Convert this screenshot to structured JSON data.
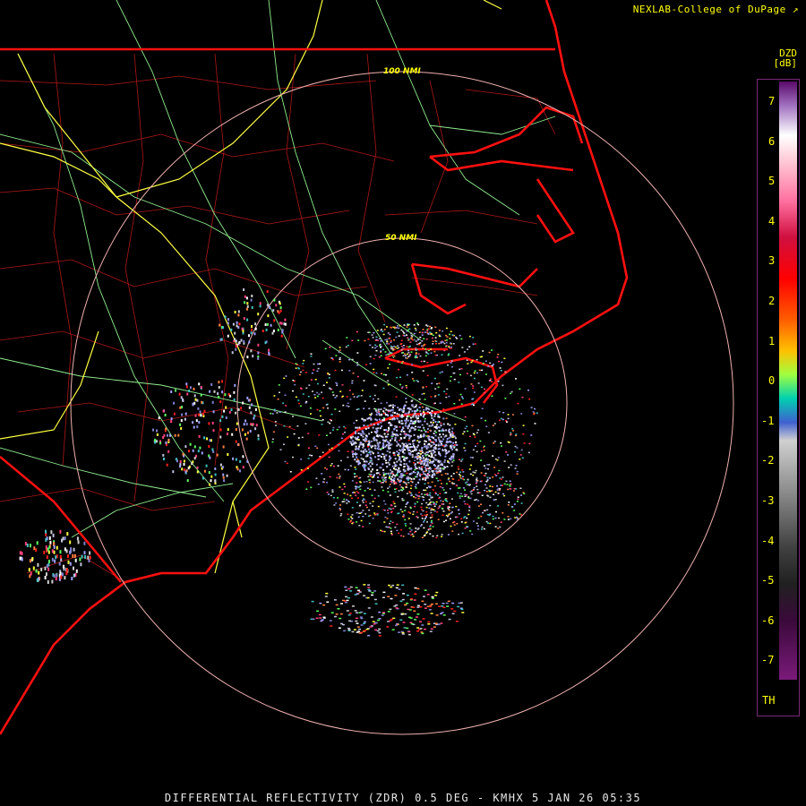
{
  "credit": "NEXLAB-College of DuPage",
  "footer": "DIFFERENTIAL REFLECTIVITY (ZDR) 0.5 DEG - KMHX 5 JAN 26 05:35",
  "rings": [
    {
      "label": "50 NMI"
    },
    {
      "label": "100 NMI"
    }
  ],
  "scale": {
    "product": "DZD",
    "unit": "[dB]",
    "labels": [
      "7",
      "6",
      "5",
      "4",
      "3",
      "2",
      "1",
      "0",
      "-1",
      "-2",
      "-3",
      "-4",
      "-5",
      "-6",
      "-7",
      "TH"
    ]
  },
  "colors": {
    "state_border": "#ff1010",
    "coast": "#ff1010",
    "county": "#b01818",
    "highway_interstate": "#ffff40",
    "highway_other": "#90ee90",
    "range_ring": "#f0b0b0"
  }
}
